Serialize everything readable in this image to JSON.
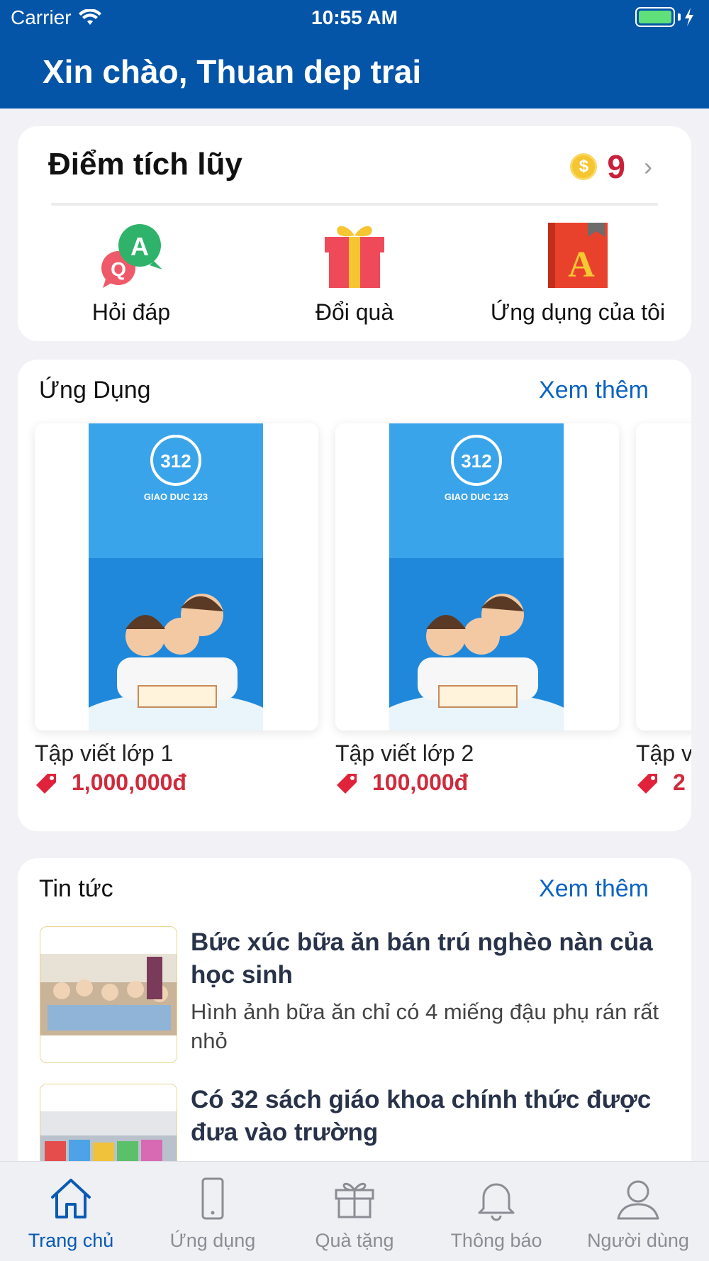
{
  "status_bar": {
    "carrier": "Carrier",
    "time": "10:55 AM"
  },
  "header": {
    "title": "Xin chào, Thuan dep trai"
  },
  "points": {
    "title": "Điểm tích lũy",
    "coin_symbol": "$",
    "value": "9",
    "chevron": "›",
    "actions": [
      {
        "label": "Hỏi đáp",
        "icon": "qa-chat-icon"
      },
      {
        "label": "Đổi quà",
        "icon": "gift-box-icon"
      },
      {
        "label": "Ứng dụng của tôi",
        "icon": "book-a-icon"
      }
    ]
  },
  "apps": {
    "title": "Ứng Dụng",
    "more": "Xem thêm",
    "items": [
      {
        "name": "Tập viết lớp 1",
        "price": "1,000,000đ"
      },
      {
        "name": "Tập viết lớp 2",
        "price": "100,000đ"
      },
      {
        "name": "Tập v",
        "price": "2"
      }
    ]
  },
  "news": {
    "title": "Tin tức",
    "more": "Xem thêm",
    "items": [
      {
        "headline": "Bức xúc bữa ăn bán trú nghèo nàn của học sinh",
        "summary": "Hình ảnh bữa ăn chỉ có 4 miếng đậu phụ rán rất nhỏ"
      },
      {
        "headline": "Có 32 sách giáo khoa chính thức được đưa vào trường",
        "summary": ""
      }
    ]
  },
  "tabbar": {
    "tabs": [
      {
        "label": "Trang chủ",
        "active": true
      },
      {
        "label": "Ứng dụng",
        "active": false
      },
      {
        "label": "Quà tặng",
        "active": false
      },
      {
        "label": "Thông báo",
        "active": false
      },
      {
        "label": "Người dùng",
        "active": false
      }
    ]
  },
  "colors": {
    "primary": "#0455a8",
    "accent_red": "#d02a3c",
    "link": "#0a63c2",
    "tab_active": "#0a5ab4"
  }
}
